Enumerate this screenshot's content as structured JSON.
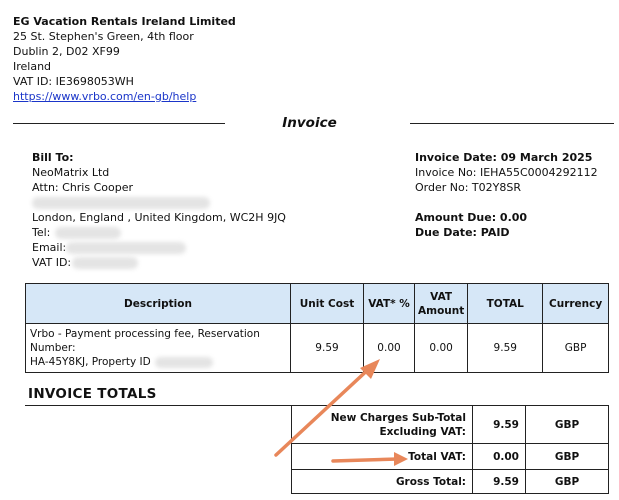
{
  "seller": {
    "name": "EG Vacation Rentals Ireland Limited",
    "address_line1": "25 St. Stephen's Green, 4th floor",
    "address_line2": "Dublin 2, D02 XF99",
    "country": "Ireland",
    "vat_id": "VAT ID: IE3698053WH",
    "link": "https://www.vrbo.com/en-gb/help"
  },
  "document": {
    "title": "Invoice"
  },
  "bill_to": {
    "heading": "Bill To:",
    "company": "NeoMatrix Ltd",
    "attn": "Attn: Chris Cooper",
    "address": "London, England , United Kingdom, WC2H 9JQ",
    "tel_label": "Tel:",
    "email_label": "Email:",
    "vat_label": "VAT ID:"
  },
  "invoice_info": {
    "date": "Invoice Date: 09 March 2025",
    "number": "Invoice No: IEHA55C0004292112",
    "order": "Order No: T02Y8SR",
    "amount_due": "Amount Due: 0.00",
    "due_date_label": "Due Date: ",
    "due_date_value": "PAID"
  },
  "items_table": {
    "headers": [
      "Description",
      "Unit Cost",
      "VAT* %",
      "VAT Amount",
      "TOTAL",
      "Currency"
    ],
    "rows": [
      {
        "description_line1": "Vrbo - Payment processing fee, Reservation Number:",
        "description_line2": "HA-45Y8KJ, Property ID",
        "unit_cost": "9.59",
        "vat_pct": "0.00",
        "vat_amount": "0.00",
        "total": "9.59",
        "currency": "GBP"
      }
    ]
  },
  "totals": {
    "heading": "INVOICE TOTALS",
    "rows": [
      {
        "label_line1": "New Charges Sub-Total",
        "label_line2": "Excluding VAT:",
        "value": "9.59",
        "currency": "GBP"
      },
      {
        "label_line1": "Total VAT:",
        "label_line2": "",
        "value": "0.00",
        "currency": "GBP"
      },
      {
        "label_line1": "Gross Total:",
        "label_line2": "",
        "value": "9.59",
        "currency": "GBP"
      }
    ]
  },
  "annotation_color": "#e8875a"
}
